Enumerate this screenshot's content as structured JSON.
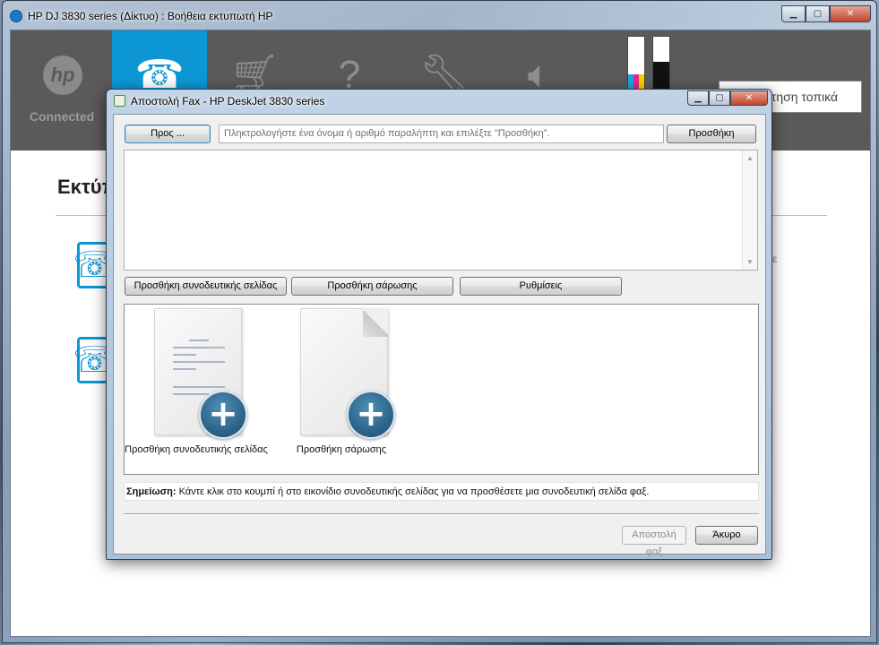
{
  "main_window": {
    "title": "HP DJ 3830 series (Δίκτυο) : Βοήθεια εκτυπωτή HP",
    "toolbar": {
      "hp_label": "Connected",
      "items": [
        {
          "icon": "fax-icon",
          "active": true
        },
        {
          "icon": "shopping-cart-icon"
        },
        {
          "icon": "help-icon"
        },
        {
          "icon": "wrench-icon"
        },
        {
          "icon": "speaker-icon"
        }
      ],
      "ink": {
        "color_level": 0.33,
        "black_level": 0.55
      },
      "search_text": "ήτηση τοπικά"
    },
    "content": {
      "heading": "Εκτύπ",
      "side_mark": "ε"
    }
  },
  "fax_dialog": {
    "title": "Αποστολή Fax - HP DeskJet 3830 series",
    "to_button": "Προς ...",
    "recipient_placeholder": "Πληκτρολογήστε ένα όνομα ή αριθμό παραλήπτη και επιλέξτε \"Προσθήκη\".",
    "add_button": "Προσθήκη",
    "add_cover_button": "Προσθήκη συνοδευτικής σελίδας",
    "add_scan_button": "Προσθήκη σάρωσης",
    "settings_button": "Ρυθμίσεις",
    "tiles": {
      "cover_caption": "Προσθήκη συνοδευτικής σελίδας",
      "scan_caption": "Προσθήκη σάρωσης"
    },
    "note_label": "Σημείωση:",
    "note_text": " Κάντε κλικ στο κουμπί ή στο εικονίδιο συνοδευτικής σελίδας για να προσθέσετε μια συνοδευτική σελίδα φαξ.",
    "send_button": "Αποστολή φαξ",
    "cancel_button": "Άκυρο"
  }
}
